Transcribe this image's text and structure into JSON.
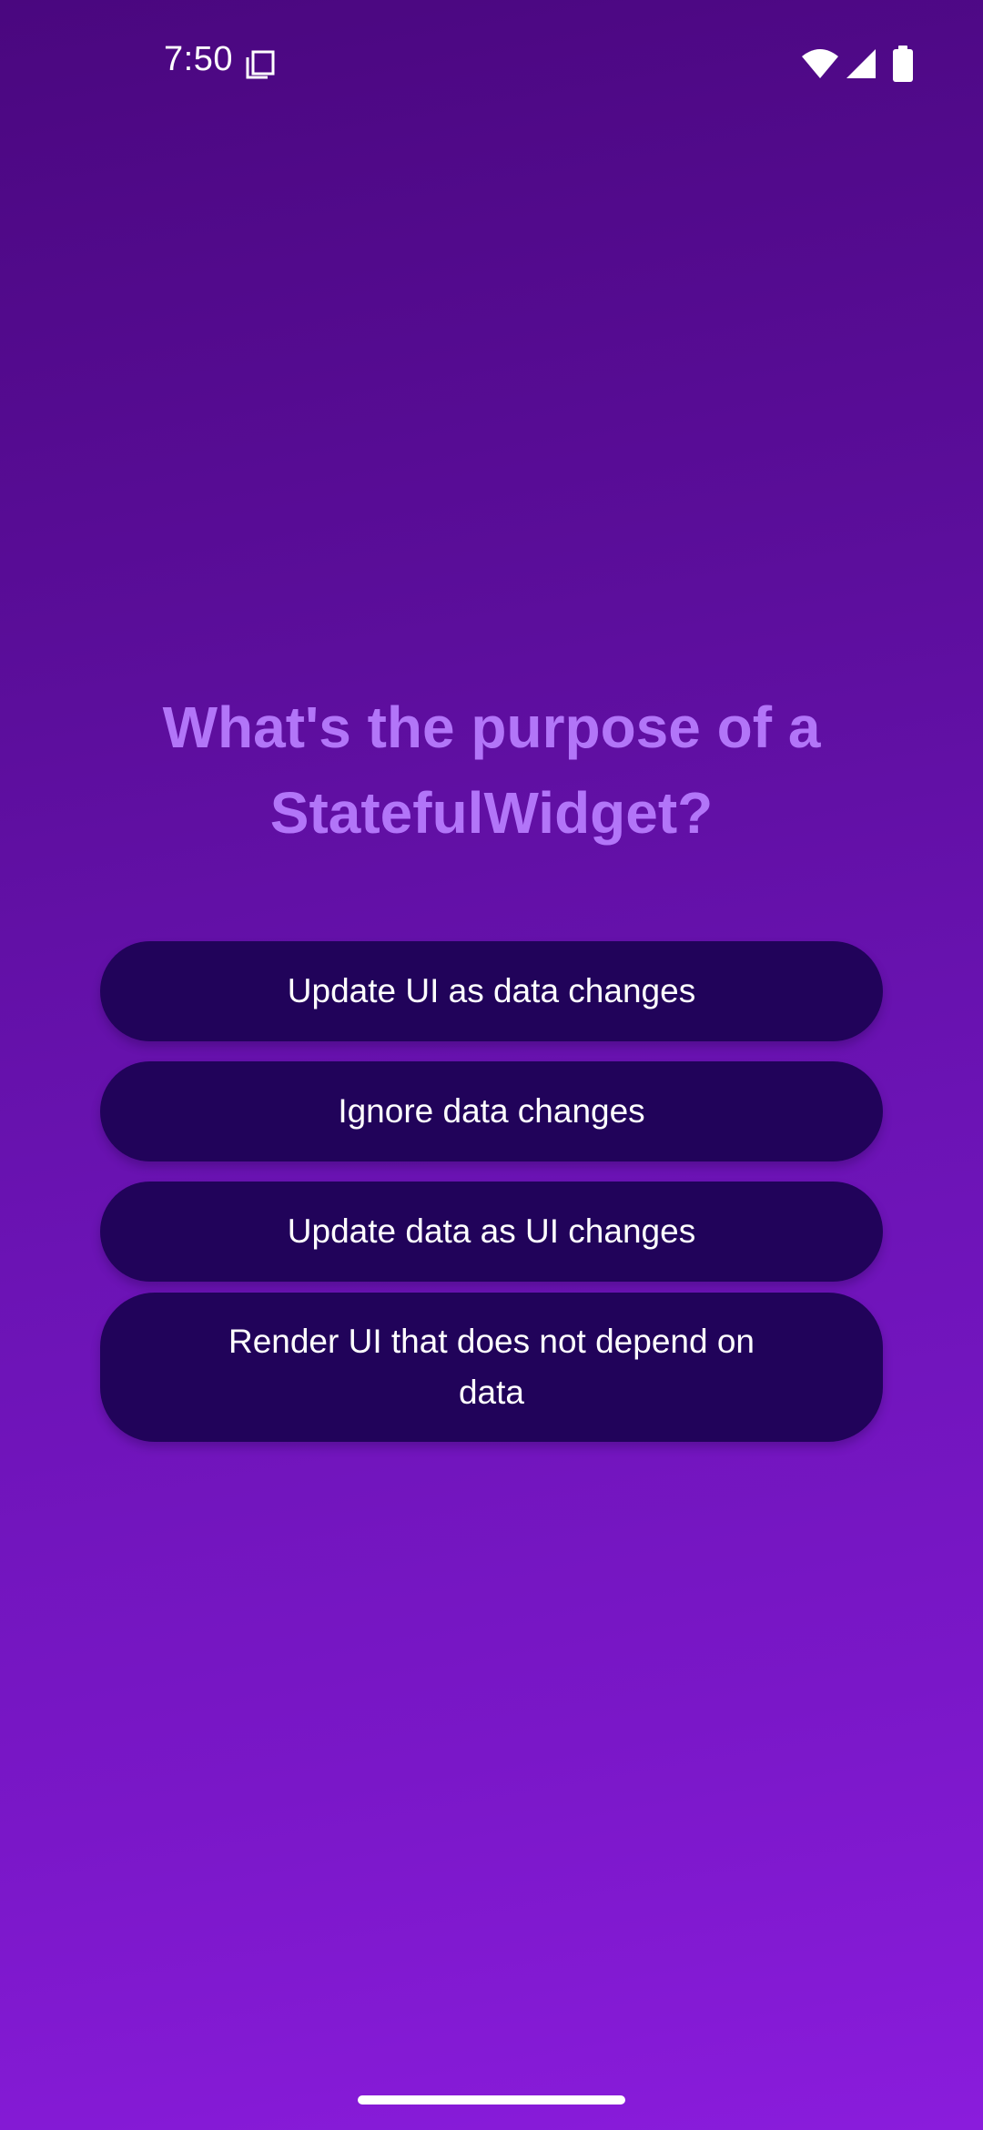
{
  "status_bar": {
    "time": "7:50",
    "icons": [
      "notification-copy-icon",
      "wifi-icon",
      "signal-icon",
      "battery-icon"
    ]
  },
  "quiz": {
    "question": "What's the purpose of a StatefulWidget?",
    "answers": [
      "Update UI as data changes",
      "Ignore data changes",
      "Update data as UI changes",
      "Render UI that does not depend on data"
    ]
  },
  "colors": {
    "background_top": "#4a077f",
    "background_bottom": "#8a1cdc",
    "question_text": "#b275f8",
    "button_background": "#21035a",
    "button_text": "#ffffff"
  }
}
